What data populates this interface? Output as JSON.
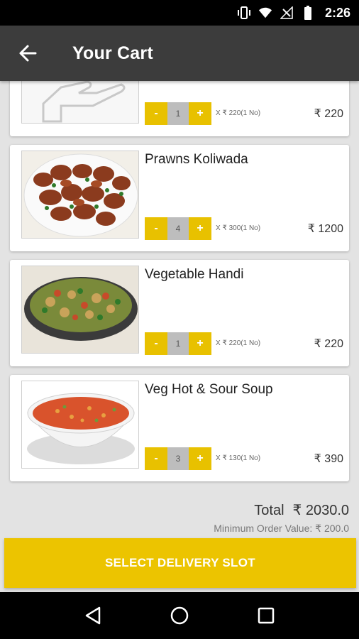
{
  "status_bar": {
    "time": "2:26"
  },
  "app_bar": {
    "title": "Your Cart",
    "back_icon": "arrow-left-icon"
  },
  "cart_items": [
    {
      "name": "",
      "qty": "1",
      "unit_price": "X ₹ 220(1 No)",
      "line_total": "₹ 220",
      "minus": "-",
      "plus": "+"
    },
    {
      "name": "Prawns Koliwada",
      "qty": "4",
      "unit_price": "X ₹ 300(1 No)",
      "line_total": "₹ 1200",
      "minus": "-",
      "plus": "+"
    },
    {
      "name": "Vegetable Handi",
      "qty": "1",
      "unit_price": "X ₹ 220(1 No)",
      "line_total": "₹ 220",
      "minus": "-",
      "plus": "+"
    },
    {
      "name": "Veg Hot & Sour Soup",
      "qty": "3",
      "unit_price": "X ₹ 130(1 No)",
      "line_total": "₹ 390",
      "minus": "-",
      "plus": "+"
    }
  ],
  "summary": {
    "total_label": "Total",
    "total_value": "₹ 2030.0",
    "min_order": "Minimum Order Value: ₹ 200.0"
  },
  "cta": {
    "label": "SELECT DELIVERY SLOT"
  },
  "colors": {
    "accent": "#ecc400",
    "app_bar": "#3c3c3c",
    "background": "#e3e3e3"
  }
}
